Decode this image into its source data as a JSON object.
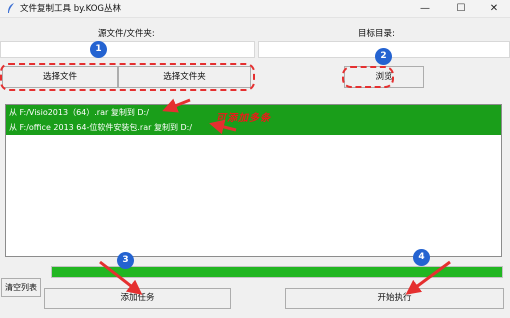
{
  "window": {
    "title": "文件复制工具 by.KOG丛林",
    "minimize": "—",
    "maximize": "☐",
    "close": "✕"
  },
  "labels": {
    "source": "源文件/文件夹:",
    "target": "目标目录:"
  },
  "buttons": {
    "select_file": "选择文件",
    "select_folder": "选择文件夹",
    "browse": "浏览",
    "clear_list": "清空列表",
    "add_task": "添加任务",
    "start": "开始执行"
  },
  "task_list": [
    "从 F:/Visio2013（64）.rar 复制到 D:/",
    "从 F:/office 2013 64-位软件安装包.rar 复制到 D:/"
  ],
  "progress": {
    "fraction": 1.0,
    "color": "#22b622"
  },
  "annotations": {
    "badges": [
      "1",
      "2",
      "3",
      "4"
    ],
    "note": "可添加多条",
    "color": "#e53030"
  }
}
